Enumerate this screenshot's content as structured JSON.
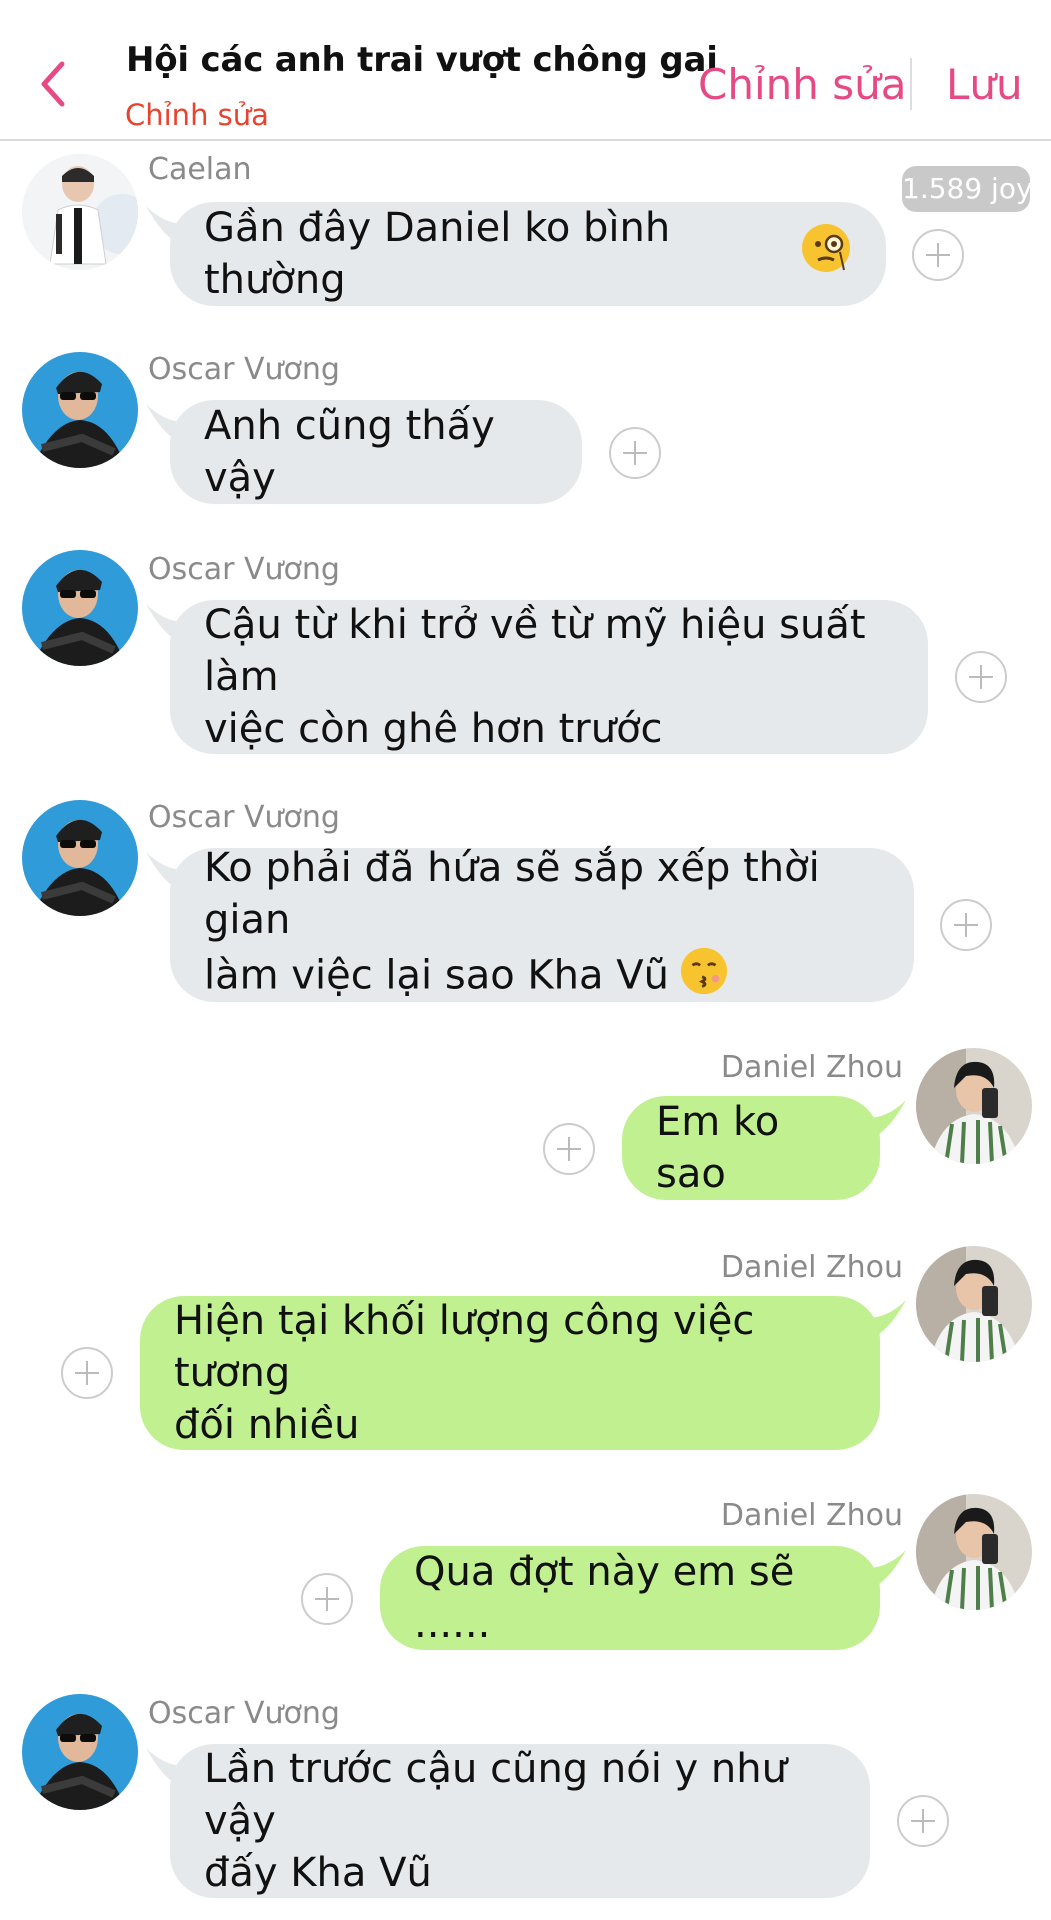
{
  "header": {
    "title": "Hội các anh trai vượt chông gai",
    "subtitle": "Chỉnh sửa",
    "edit_label": "Chỉnh sửa",
    "save_label": "Lưu"
  },
  "colors": {
    "accent": "#e64a84",
    "subtitle": "#e8432f",
    "incoming_bubble": "#e6e9ec",
    "outgoing_bubble": "#c1f090"
  },
  "badge": "1.589 joy",
  "messages": [
    {
      "sender": "Caelan",
      "side": "in",
      "lines": [
        "Gần đây Daniel ko bình thường"
      ],
      "emoji": "face-with-monocle"
    },
    {
      "sender": "Oscar Vương",
      "side": "in",
      "lines": [
        "Anh cũng thấy vậy"
      ]
    },
    {
      "sender": "Oscar Vương",
      "side": "in",
      "lines": [
        "Cậu từ khi trở về từ mỹ hiệu suất làm",
        "việc còn ghê hơn trước"
      ]
    },
    {
      "sender": "Oscar Vương",
      "side": "in",
      "lines": [
        "Ko phải đã hứa sẽ sắp xếp thời gian",
        "làm việc lại sao Kha Vũ"
      ],
      "emoji": "kissing-face"
    },
    {
      "sender": "Daniel Zhou",
      "side": "out",
      "lines": [
        "Em ko sao"
      ]
    },
    {
      "sender": "Daniel Zhou",
      "side": "out",
      "lines": [
        "Hiện tại khối lượng công việc tương",
        "đối nhiều"
      ]
    },
    {
      "sender": "Daniel Zhou",
      "side": "out",
      "lines": [
        "Qua đợt này em sẽ ......"
      ]
    },
    {
      "sender": "Oscar Vương",
      "side": "in",
      "lines": [
        "Lần trước cậu cũng nói y như vậy",
        "đấy Kha Vũ"
      ]
    }
  ]
}
